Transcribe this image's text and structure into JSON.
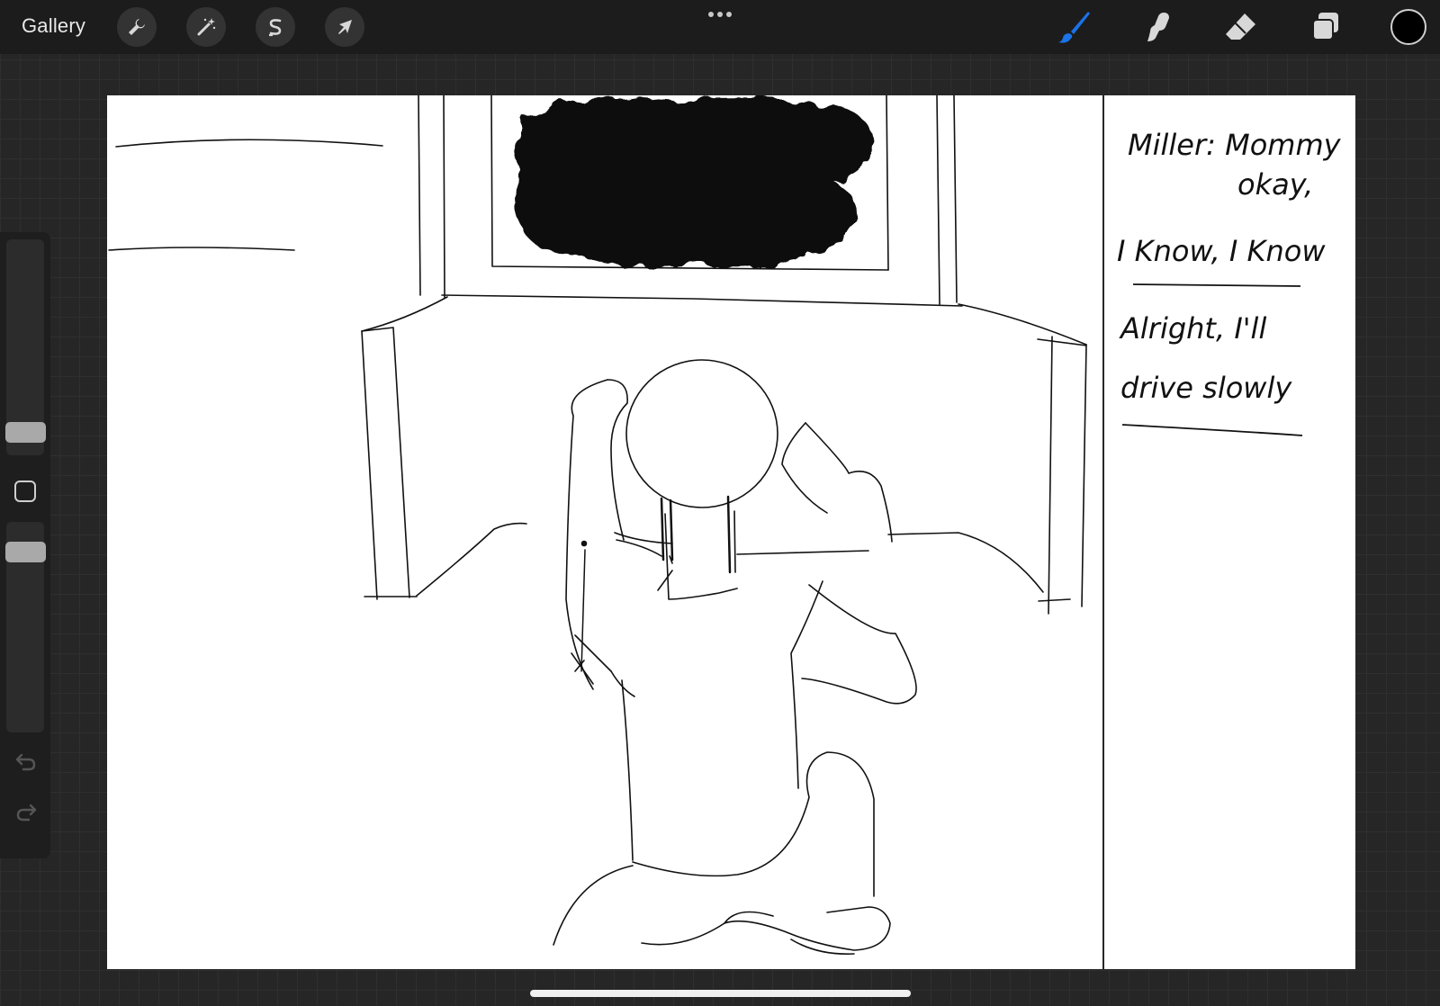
{
  "toolbar": {
    "gallery_label": "Gallery",
    "left_tools": [
      {
        "name": "actions",
        "icon": "wrench-icon"
      },
      {
        "name": "adjustments",
        "icon": "magic-wand-icon"
      },
      {
        "name": "selection",
        "icon": "selection-s-icon"
      },
      {
        "name": "transform",
        "icon": "arrow-cursor-icon"
      }
    ],
    "more_icon": "ellipsis-icon",
    "right_tools": [
      {
        "name": "brush",
        "icon": "brush-icon",
        "active": true
      },
      {
        "name": "smudge",
        "icon": "smudge-icon",
        "active": false
      },
      {
        "name": "eraser",
        "icon": "eraser-icon",
        "active": false
      },
      {
        "name": "layers",
        "icon": "layers-icon",
        "active": false
      }
    ],
    "current_color": "#000000",
    "active_color": "#1a73e8"
  },
  "sidebar": {
    "undo_icon": "undo-icon",
    "redo_icon": "redo-icon",
    "modify_icon": "square-modify-icon"
  },
  "canvas": {
    "handwritten_text": {
      "line1": "Miller: Mommy",
      "line2": "okay,",
      "line3": "I Know, I Know",
      "line4": "Alright, I'll",
      "line5": "drive slowly"
    }
  }
}
